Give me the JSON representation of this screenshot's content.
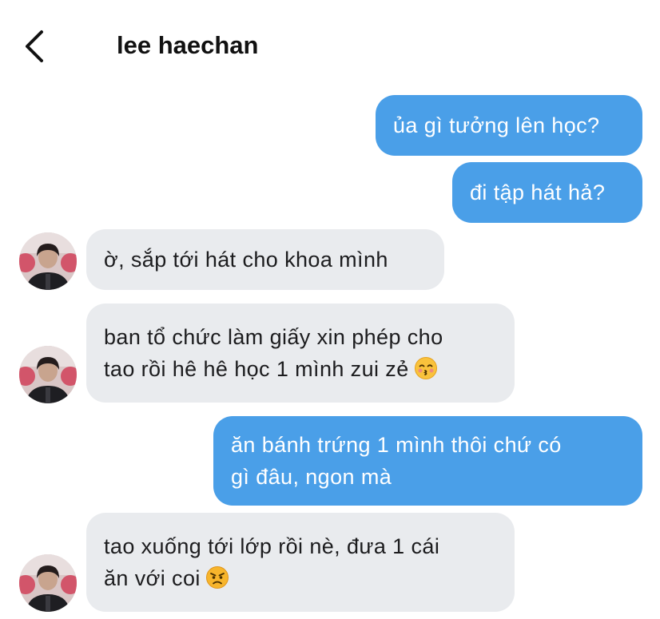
{
  "header": {
    "title": "lee haechan",
    "back_icon": "chevron-left-icon"
  },
  "colors": {
    "outgoing_bubble": "#4a9fe8",
    "incoming_bubble": "#e9ebee",
    "outgoing_text": "#ffffff",
    "incoming_text": "#1c1c1e"
  },
  "messages": [
    {
      "sender": "me",
      "text": "ủa gì tưởng lên học?"
    },
    {
      "sender": "me",
      "text": "đi tập hát hả?"
    },
    {
      "sender": "lee haechan",
      "text": "ờ, sắp tới hát cho khoa mình"
    },
    {
      "sender": "lee haechan",
      "text": "ban tổ chức làm giấy xin phép cho\ntao rồi hê hê học 1 mình zui zẻ",
      "emoji": "kissing-face-closed-eyes-emoji"
    },
    {
      "sender": "me",
      "text": "ăn bánh trứng 1 mình thôi chứ có\ngì đâu, ngon mà"
    },
    {
      "sender": "lee haechan",
      "text": "tao xuống tới lớp rồi nè, đưa 1 cái\năn với coi",
      "emoji": "angry-face-emoji"
    }
  ]
}
